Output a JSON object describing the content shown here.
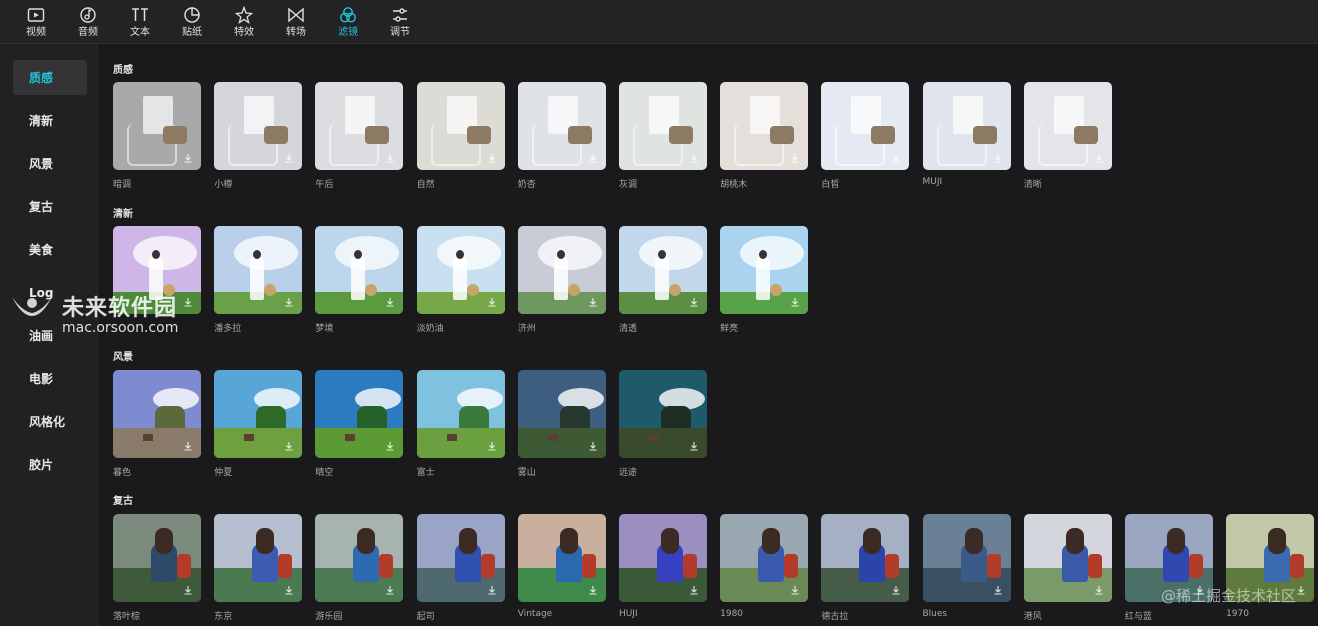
{
  "toolbar": {
    "tabs": [
      {
        "label": "视频",
        "icon": "video-icon"
      },
      {
        "label": "音频",
        "icon": "audio-icon"
      },
      {
        "label": "文本",
        "icon": "text-icon"
      },
      {
        "label": "贴纸",
        "icon": "sticker-icon"
      },
      {
        "label": "特效",
        "icon": "effects-icon"
      },
      {
        "label": "转场",
        "icon": "transition-icon"
      },
      {
        "label": "滤镜",
        "icon": "filter-icon",
        "active": true
      },
      {
        "label": "调节",
        "icon": "adjust-icon"
      }
    ]
  },
  "sidebar": {
    "items": [
      {
        "label": "质感",
        "active": true
      },
      {
        "label": "清新"
      },
      {
        "label": "风景"
      },
      {
        "label": "复古"
      },
      {
        "label": "美食"
      },
      {
        "label": "Log"
      },
      {
        "label": "油画"
      },
      {
        "label": "电影"
      },
      {
        "label": "风格化"
      },
      {
        "label": "胶片"
      }
    ]
  },
  "sections": [
    {
      "title": "质感",
      "items": [
        "暗调",
        "小樽",
        "午后",
        "自然",
        "奶杏",
        "灰调",
        "胡桃木",
        "白皙",
        "MUJI",
        "清晰"
      ]
    },
    {
      "title": "清新",
      "items": [
        "",
        "潘多拉",
        "梦境",
        "淡奶油",
        "济州",
        "清透",
        "鲜亮"
      ]
    },
    {
      "title": "风景",
      "items": [
        "暮色",
        "仲夏",
        "晴空",
        "富士",
        "雾山",
        "远途"
      ]
    },
    {
      "title": "复古",
      "items": [
        "落叶棕",
        "东京",
        "游乐园",
        "起司",
        "Vintage",
        "HUJI",
        "1980",
        "德古拉",
        "Blues",
        "港风",
        "红与蓝",
        "1970"
      ]
    }
  ],
  "watermark": {
    "title": "未来软件园",
    "url": "mac.orsoon.com"
  },
  "watermark2": "@稀土掘金技术社区",
  "colors": {
    "accent": "#21c2d8",
    "background": "#1a1a1c",
    "sidebar": "#212123",
    "toolbar": "#232325"
  }
}
